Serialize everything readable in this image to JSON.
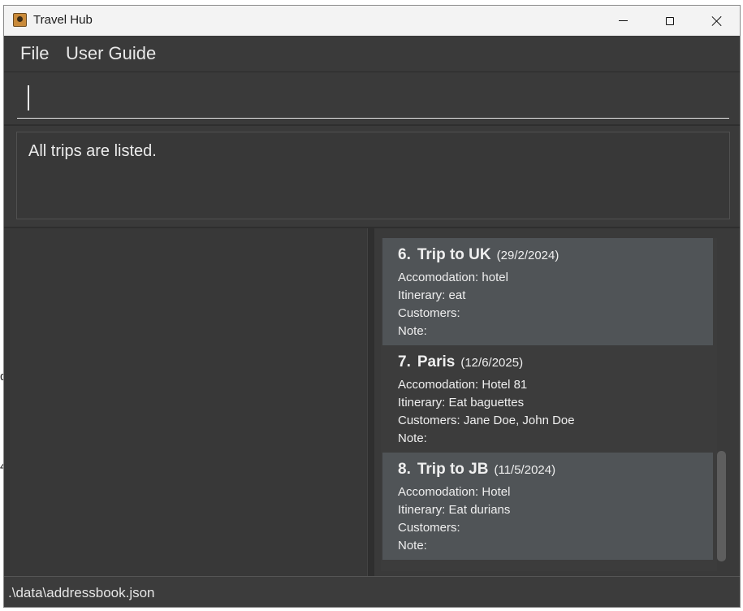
{
  "window": {
    "title": "Travel Hub",
    "icon": "contact-book-icon"
  },
  "menu": {
    "file": "File",
    "user_guide": "User Guide"
  },
  "command": {
    "value": "",
    "placeholder": ""
  },
  "result": {
    "message": "All trips are listed."
  },
  "trips": [
    {
      "index": "6.",
      "name": "Trip to UK",
      "date": "(29/2/2024)",
      "accommodation": "Accomodation: hotel",
      "itinerary": "Itinerary: eat",
      "customers": "Customers:",
      "note": "Note:"
    },
    {
      "index": "7.",
      "name": "Paris",
      "date": "(12/6/2025)",
      "accommodation": "Accomodation: Hotel 81",
      "itinerary": "Itinerary: Eat baguettes",
      "customers": "Customers: Jane Doe, John Doe",
      "note": "Note:"
    },
    {
      "index": "8.",
      "name": "Trip to JB",
      "date": "(11/5/2024)",
      "accommodation": "Accomodation: Hotel",
      "itinerary": "Itinerary: Eat durians",
      "customers": "Customers:",
      "note": "Note:"
    }
  ],
  "status": {
    "path": ".\\data\\addressbook.json"
  },
  "colors": {
    "window_bg": "#3a3a3a",
    "card_shaded": "#505457",
    "titlebar": "#f3f3f3"
  }
}
